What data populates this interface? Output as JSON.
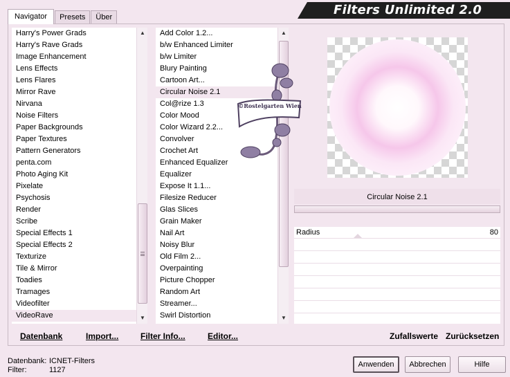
{
  "title": "Filters Unlimited 2.0",
  "tabs": [
    "Navigator",
    "Presets",
    "Über"
  ],
  "categories": [
    "Harry's Power Grads",
    "Harry's Rave Grads",
    "Image Enhancement",
    "Lens Effects",
    "Lens Flares",
    "Mirror Rave",
    "Nirvana",
    "Noise Filters",
    "Paper Backgrounds",
    "Paper Textures",
    "Pattern Generators",
    "penta.com",
    "Photo Aging Kit",
    "Pixelate",
    "Psychosis",
    "Render",
    "Scribe",
    "Special Effects 1",
    "Special Effects 2",
    "Texturize",
    "Tile & Mirror",
    "Toadies",
    "Tramages",
    "Videofilter",
    "VideoRave"
  ],
  "categories_selected": 24,
  "filters": [
    "Add Color 1.2...",
    "b/w Enhanced Limiter",
    "b/w Limiter",
    "Blury Painting",
    "Cartoon Art...",
    "Circular Noise 2.1",
    "Col@rize 1.3",
    "Color Mood",
    "Color Wizard 2.2...",
    "Convolver",
    "Crochet Art",
    "Enhanced Equalizer",
    "Equalizer",
    "Expose It 1.1...",
    "Filesize Reducer",
    "Glas Slices",
    "Grain Maker",
    "Nail Art",
    "Noisy Blur",
    "Old Film 2...",
    "Overpainting",
    "Picture Chopper",
    "Random Art",
    "Streamer...",
    "Swirl Distortion"
  ],
  "filters_selected": 5,
  "buttons_left": {
    "database": "Datenbank",
    "import": "Import...",
    "filter_info": "Filter Info...",
    "editor": "Editor..."
  },
  "buttons_right": {
    "random": "Zufallswerte",
    "reset": "Zurücksetzen"
  },
  "watermark": "©Rostelgarten Wien",
  "preview": {
    "filter_name": "Circular Noise 2.1"
  },
  "params": [
    {
      "label": "Radius",
      "value": "80"
    }
  ],
  "footer": {
    "db_label": "Datenbank:",
    "db_value": "ICNET-Filters",
    "filter_label": "Filter:",
    "filter_value": "1127",
    "apply": "Anwenden",
    "cancel": "Abbrechen",
    "help": "Hilfe"
  },
  "colors": {
    "accent_pink": "#f6c7ea",
    "banner": "#1f1f1f",
    "panel": "#f3e6ef"
  }
}
